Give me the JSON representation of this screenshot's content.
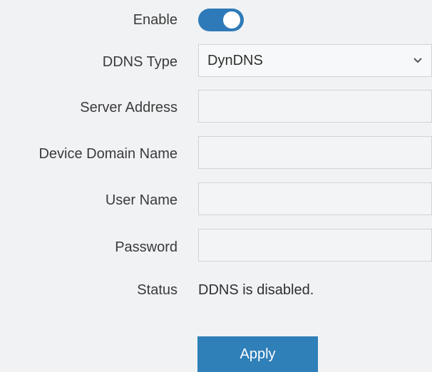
{
  "enable": {
    "label": "Enable",
    "state": "on"
  },
  "ddns_type": {
    "label": "DDNS Type",
    "value": "DynDNS",
    "icon": "chevron-down-icon"
  },
  "server_address": {
    "label": "Server Address",
    "value": ""
  },
  "device_domain_name": {
    "label": "Device Domain Name",
    "value": ""
  },
  "user_name": {
    "label": "User Name",
    "value": ""
  },
  "password": {
    "label": "Password",
    "value": ""
  },
  "status": {
    "label": "Status",
    "value": "DDNS is disabled."
  },
  "apply_button": {
    "label": "Apply"
  },
  "colors": {
    "accent": "#2e7ab8",
    "panel_bg": "#f1f2f4"
  }
}
